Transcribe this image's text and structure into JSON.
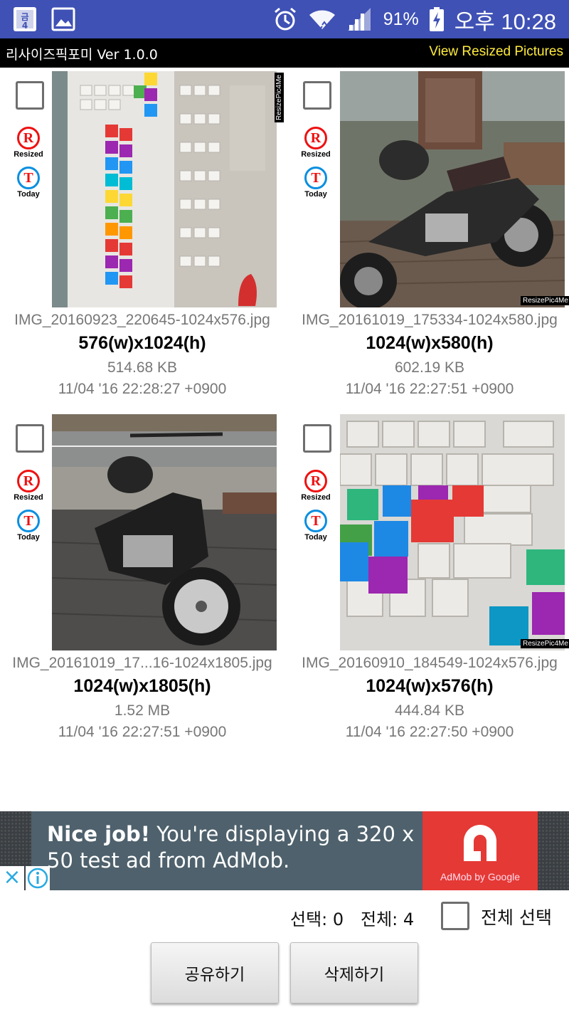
{
  "status_bar": {
    "battery": "91%",
    "time": "오후 10:28"
  },
  "header": {
    "app_title": "리사이즈픽포미 Ver 1.0.0",
    "view_link": "View Resized Pictures"
  },
  "badges": {
    "resized_letter": "R",
    "resized_label": "Resized",
    "today_letter": "T",
    "today_label": "Today"
  },
  "watermark_text": "ResizePic4Me",
  "items": [
    {
      "filename": "IMG_20160923_220645-1024x576.jpg",
      "dims": "576(w)x1024(h)",
      "size": "514.68 KB",
      "date": "11/04 '16 22:28:27 +0900",
      "checked": false
    },
    {
      "filename": "IMG_20161019_175334-1024x580.jpg",
      "dims": "1024(w)x580(h)",
      "size": "602.19 KB",
      "date": "11/04 '16 22:27:51 +0900",
      "checked": false
    },
    {
      "filename": "IMG_20161019_17...16-1024x1805.jpg",
      "dims": "1024(w)x1805(h)",
      "size": "1.52 MB",
      "date": "11/04 '16 22:27:51 +0900",
      "checked": false
    },
    {
      "filename": "IMG_20160910_184549-1024x576.jpg",
      "dims": "1024(w)x576(h)",
      "size": "444.84 KB",
      "date": "11/04 '16 22:27:50 +0900",
      "checked": false
    }
  ],
  "ad": {
    "headline": "Nice job!",
    "body": " You're displaying a 320 x 50 test ad from AdMob.",
    "brand": "AdMob by Google"
  },
  "footer": {
    "selected_text": "선택: 0",
    "total_text": "전체: 4",
    "select_all_label": "전체 선택",
    "share_button": "공유하기",
    "delete_button": "삭제하기"
  },
  "colors": {
    "status_bar": "#3F51B5",
    "link": "#FFEB3B",
    "ad_red": "#E53935"
  }
}
